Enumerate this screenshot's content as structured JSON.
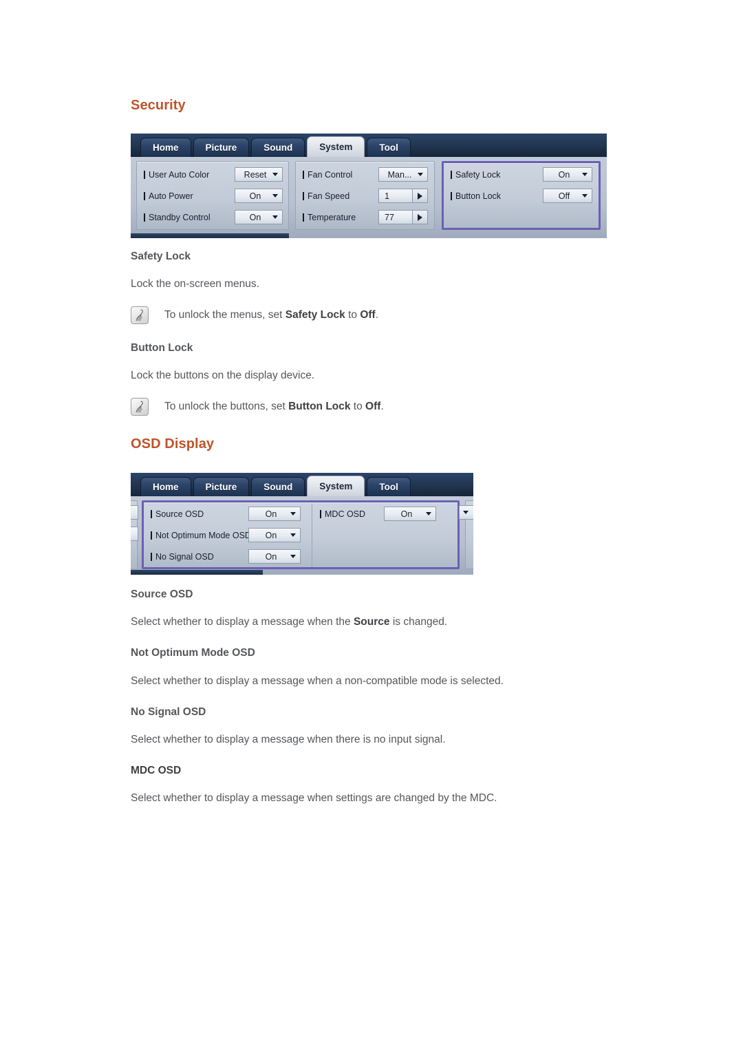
{
  "sections": [
    {
      "title": "Security",
      "screenshot": {
        "tabs": [
          {
            "label": "Home",
            "active": false
          },
          {
            "label": "Picture",
            "active": false
          },
          {
            "label": "Sound",
            "active": false
          },
          {
            "label": "System",
            "active": true
          },
          {
            "label": "Tool",
            "active": false
          }
        ],
        "columns": [
          {
            "highlighted": false,
            "rows": [
              {
                "label": "User Auto Color",
                "control": "select",
                "value": "Reset"
              },
              {
                "label": "Auto Power",
                "control": "select",
                "value": "On"
              },
              {
                "label": "Standby Control",
                "control": "select",
                "value": "On"
              }
            ]
          },
          {
            "highlighted": false,
            "rows": [
              {
                "label": "Fan Control",
                "control": "select",
                "value": "Man..."
              },
              {
                "label": "Fan Speed",
                "control": "spinner",
                "value": "1"
              },
              {
                "label": "Temperature",
                "control": "spinner",
                "value": "77"
              }
            ]
          },
          {
            "highlighted": true,
            "rows": [
              {
                "label": "Safety Lock",
                "control": "select",
                "value": "On"
              },
              {
                "label": "Button Lock",
                "control": "select",
                "value": "Off"
              }
            ]
          }
        ]
      },
      "topics": [
        {
          "heading": "Safety Lock",
          "body_plain": "Lock the on-screen menus.",
          "note": {
            "icon": "note-pen-icon",
            "pre": "To unlock the menus, set ",
            "bold1": "Safety Lock",
            "mid": " to ",
            "bold2": "Off",
            "post": "."
          }
        },
        {
          "heading": "Button Lock",
          "body_plain": "Lock the buttons on the display device.",
          "note": {
            "icon": "note-pen-icon",
            "pre": "To unlock the buttons, set ",
            "bold1": "Button Lock",
            "mid": " to ",
            "bold2": "Off",
            "post": "."
          }
        }
      ]
    },
    {
      "title": "OSD Display",
      "screenshot": {
        "tabs": [
          {
            "label": "Home",
            "active": false
          },
          {
            "label": "Picture",
            "active": false
          },
          {
            "label": "Sound",
            "active": false
          },
          {
            "label": "System",
            "active": true
          },
          {
            "label": "Tool",
            "active": false
          }
        ],
        "columns": [
          {
            "highlighted": true,
            "rows": [
              {
                "label": "Source OSD",
                "control": "select",
                "value": "On"
              },
              {
                "label": "Not Optimum Mode OSD",
                "control": "select",
                "value": "On"
              },
              {
                "label": "No Signal OSD",
                "control": "select",
                "value": "On"
              }
            ]
          },
          {
            "highlighted": true,
            "rows": [
              {
                "label": "MDC OSD",
                "control": "select",
                "value": "On"
              }
            ]
          }
        ]
      },
      "topics": [
        {
          "heading": "Source OSD",
          "body_pre": "Select whether to display a message when the ",
          "body_bold": "Source",
          "body_post": " is changed."
        },
        {
          "heading": "Not Optimum Mode OSD",
          "body_plain": "Select whether to display a message when a non-compatible mode is selected."
        },
        {
          "heading": "No Signal OSD",
          "body_plain": "Select whether to display a message when there is no input signal."
        },
        {
          "heading": "MDC OSD",
          "body_plain": "Select whether to display a message when settings are changed by the MDC."
        }
      ]
    }
  ],
  "colors": {
    "heading_orange": "#c0532a",
    "text_grey": "#55565a",
    "panel_highlight_purple": "#6b5fb5",
    "osd_tab_navy": "#1f3550"
  }
}
